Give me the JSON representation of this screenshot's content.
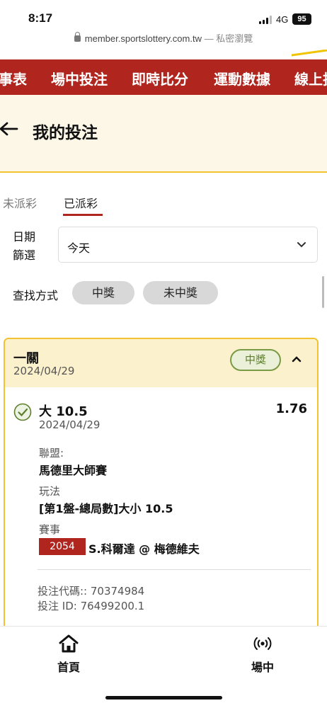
{
  "status_bar": {
    "time": "8:17",
    "network": "4G",
    "battery": "95"
  },
  "browser": {
    "url": "member.sportslottery.com.tw",
    "mode": "— 私密瀏覽"
  },
  "nav": {
    "items": [
      "事表",
      "場中投注",
      "即時比分",
      "運動數據",
      "線上投"
    ]
  },
  "header": {
    "title": "我的投注"
  },
  "tabs": {
    "unsettled": "未派彩",
    "settled": "已派彩"
  },
  "filter": {
    "date_label": "日期篩選",
    "date_value": "今天",
    "search_label": "查找方式",
    "chip_win": "中獎",
    "chip_lose": "未中獎"
  },
  "bet": {
    "type": "一關",
    "date": "2024/04/29",
    "result": "中獎",
    "selection": "大 10.5",
    "selection_date": "2024/04/29",
    "odds": "1.76",
    "league_label": "聯盟:",
    "league": "馬德里大師賽",
    "play_label": "玩法",
    "play": "[第1盤-總局數]大小 10.5",
    "event_label": "賽事",
    "event_code": "2054",
    "event_name": "S.科爾達 @ 梅德維夫",
    "bet_code": "投注代碼:: 70374984",
    "bet_id": "投注 ID: 76499200.1"
  },
  "bottom_tabs": {
    "home": "首頁",
    "live": "場中"
  },
  "colors": {
    "brand_red": "#b0261e",
    "accent_yellow": "#f2c230",
    "win_green": "#5d7f2c"
  }
}
